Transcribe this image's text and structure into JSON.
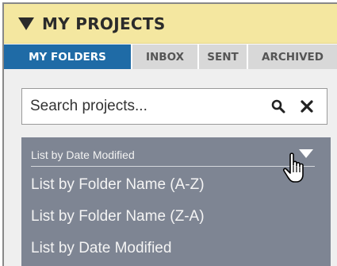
{
  "header": {
    "title": "MY PROJECTS",
    "icon": "triangle-down-icon"
  },
  "tabs": [
    {
      "label": "MY FOLDERS",
      "active": true
    },
    {
      "label": "INBOX",
      "active": false
    },
    {
      "label": "SENT",
      "active": false
    },
    {
      "label": "ARCHIVED",
      "active": false
    }
  ],
  "search": {
    "placeholder": "Search projects...",
    "value": ""
  },
  "sort": {
    "selected": "List by Date Modified",
    "options": [
      "List by Folder Name (A-Z)",
      "List by Folder Name (Z-A)",
      "List by Date Modified"
    ]
  },
  "colors": {
    "header_bg": "#f4e7a0",
    "tab_active": "#1f6ba6",
    "tab_inactive": "#d8d8d8",
    "dropdown_bg": "#7e8593"
  }
}
